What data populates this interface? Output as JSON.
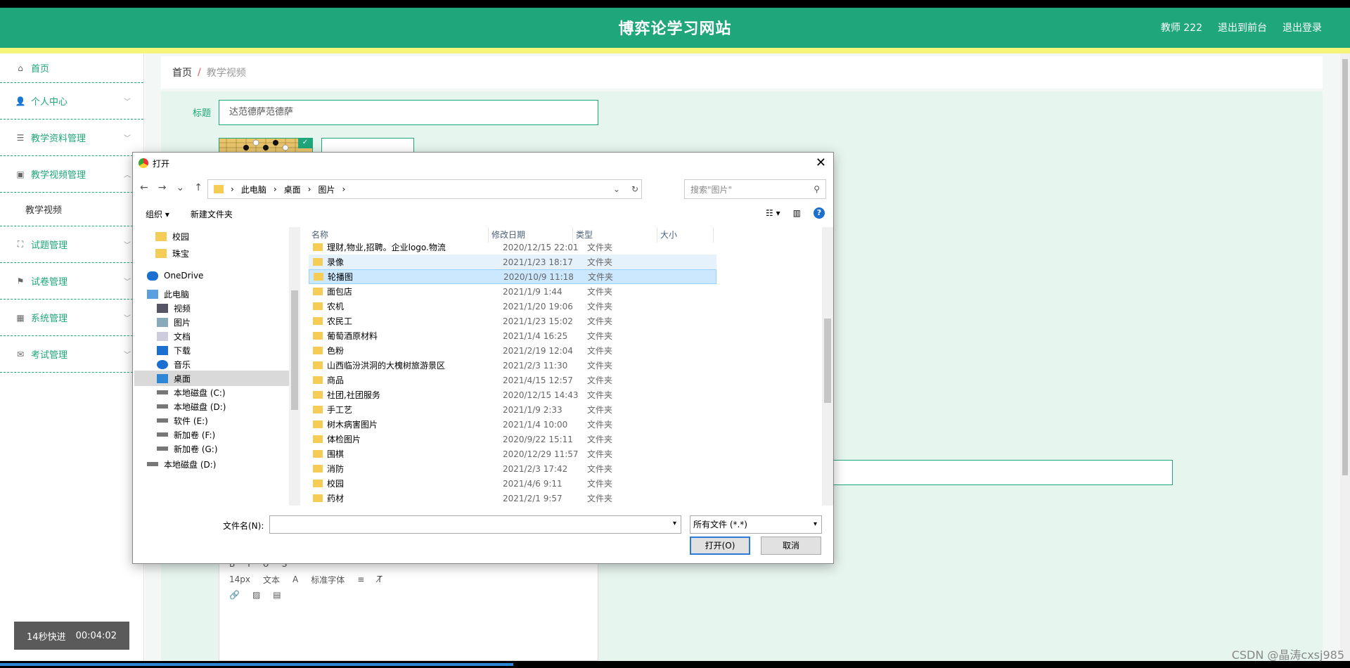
{
  "header": {
    "title": "博弈论学习网站",
    "user": "教师 222",
    "to_front": "退出到前台",
    "logout": "退出登录"
  },
  "sidebar": {
    "items": [
      {
        "label": "首页",
        "icon": "home-icon"
      },
      {
        "label": "个人中心",
        "icon": "user-icon"
      },
      {
        "label": "教学资料管理",
        "icon": "list-icon"
      },
      {
        "label": "教学视频管理",
        "icon": "clipboard-icon"
      },
      {
        "label": "教学视频",
        "icon": ""
      },
      {
        "label": "试题管理",
        "icon": "fullscreen-icon"
      },
      {
        "label": "试卷管理",
        "icon": "flag-icon"
      },
      {
        "label": "系统管理",
        "icon": "grid-icon"
      },
      {
        "label": "考试管理",
        "icon": "mail-icon"
      }
    ]
  },
  "breadcrumb": {
    "home": "首页",
    "sep": "/",
    "current": "教学视频"
  },
  "form": {
    "title_label": "标题",
    "title_value": "达范德萨范德萨"
  },
  "editor": {
    "font_size": "14px",
    "paragraph": "文本",
    "font_family": "标准字体"
  },
  "timer": {
    "label": "14秒快进",
    "time": "00:04:02"
  },
  "watermark": "CSDN @晶涛cxsj985",
  "dialog": {
    "title": "打开",
    "path": [
      "此电脑",
      "桌面",
      "图片"
    ],
    "search_placeholder": "搜索\"图片\"",
    "organize": "组织 ▾",
    "new_folder": "新建文件夹",
    "nav": [
      {
        "label": "校园",
        "type": "folder"
      },
      {
        "label": "珠宝",
        "type": "folder"
      },
      {
        "label": "OneDrive",
        "type": "cloud"
      },
      {
        "label": "此电脑",
        "type": "pc"
      },
      {
        "label": "视频",
        "type": "video"
      },
      {
        "label": "图片",
        "type": "picture"
      },
      {
        "label": "文档",
        "type": "doc"
      },
      {
        "label": "下载",
        "type": "download"
      },
      {
        "label": "音乐",
        "type": "music"
      },
      {
        "label": "桌面",
        "type": "desktop"
      },
      {
        "label": "本地磁盘 (C:)",
        "type": "drive"
      },
      {
        "label": "本地磁盘 (D:)",
        "type": "drive"
      },
      {
        "label": "软件 (E:)",
        "type": "drive"
      },
      {
        "label": "新加卷 (F:)",
        "type": "drive"
      },
      {
        "label": "新加卷 (G:)",
        "type": "drive"
      },
      {
        "label": "本地磁盘 (D:)",
        "type": "drive"
      }
    ],
    "columns": [
      "名称",
      "修改日期",
      "类型",
      "大小"
    ],
    "files": [
      {
        "name": "理财,物业,招聘。企业logo.物流",
        "date": "2020/12/15 22:01",
        "type": "文件夹"
      },
      {
        "name": "录像",
        "date": "2021/1/23 18:17",
        "type": "文件夹"
      },
      {
        "name": "轮播图",
        "date": "2020/10/9 11:18",
        "type": "文件夹"
      },
      {
        "name": "面包店",
        "date": "2021/1/9 1:44",
        "type": "文件夹"
      },
      {
        "name": "农机",
        "date": "2021/1/20 19:06",
        "type": "文件夹"
      },
      {
        "name": "农民工",
        "date": "2021/1/23 15:02",
        "type": "文件夹"
      },
      {
        "name": "葡萄酒原材料",
        "date": "2021/1/4 16:25",
        "type": "文件夹"
      },
      {
        "name": "色粉",
        "date": "2021/2/19 12:04",
        "type": "文件夹"
      },
      {
        "name": "山西临汾洪洞的大槐树旅游景区",
        "date": "2021/2/3 11:30",
        "type": "文件夹"
      },
      {
        "name": "商品",
        "date": "2021/4/15 12:57",
        "type": "文件夹"
      },
      {
        "name": "社团,社团服务",
        "date": "2020/12/15 14:43",
        "type": "文件夹"
      },
      {
        "name": "手工艺",
        "date": "2021/1/9 2:33",
        "type": "文件夹"
      },
      {
        "name": "树木病害图片",
        "date": "2021/1/4 10:00",
        "type": "文件夹"
      },
      {
        "name": "体检图片",
        "date": "2020/9/22 15:11",
        "type": "文件夹"
      },
      {
        "name": "围棋",
        "date": "2020/12/29 11:57",
        "type": "文件夹"
      },
      {
        "name": "消防",
        "date": "2021/2/3 17:42",
        "type": "文件夹"
      },
      {
        "name": "校园",
        "date": "2021/4/6 9:11",
        "type": "文件夹"
      },
      {
        "name": "药材",
        "date": "2021/2/1 9:57",
        "type": "文件夹"
      }
    ],
    "filename_label": "文件名(N):",
    "filename_value": "",
    "filetype": "所有文件 (*.*)",
    "open_btn": "打开(O)",
    "cancel_btn": "取消"
  }
}
